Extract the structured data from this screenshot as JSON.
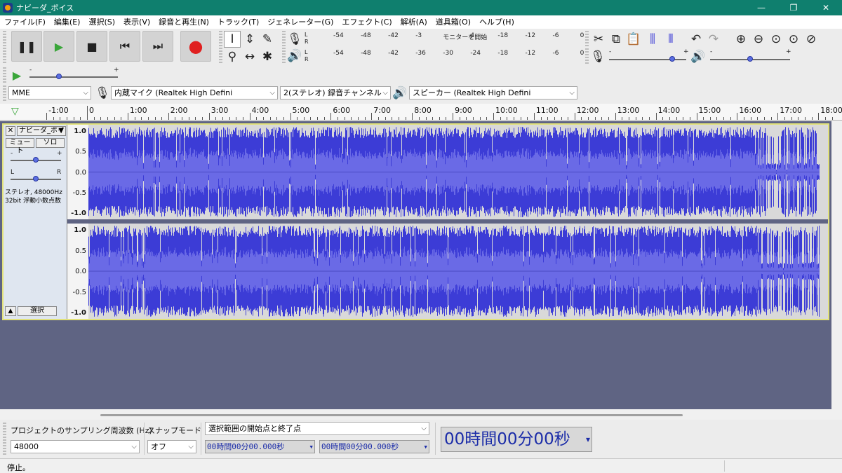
{
  "window": {
    "title": "ナビーダ_ボイス",
    "minimize_glyph": "—",
    "maximize_glyph": "❐",
    "close_glyph": "✕"
  },
  "menu": [
    "ファイル(F)",
    "編集(E)",
    "選択(S)",
    "表示(V)",
    "録音と再生(N)",
    "トラック(T)",
    "ジェネレーター(G)",
    "エフェクト(C)",
    "解析(A)",
    "道具箱(O)",
    "ヘルプ(H)"
  ],
  "transport": {
    "buttons": [
      {
        "name": "pause-button",
        "icon": "pause-icon",
        "glyph": "❚❚",
        "color": "#222222"
      },
      {
        "name": "play-button",
        "icon": "play-icon",
        "glyph": "▶",
        "color": "#3aa63a"
      },
      {
        "name": "stop-button",
        "icon": "stop-icon",
        "glyph": "■",
        "color": "#222222"
      },
      {
        "name": "skip-start-button",
        "icon": "skip-start-icon",
        "glyph": "⏮",
        "color": "#222222"
      },
      {
        "name": "skip-end-button",
        "icon": "skip-end-icon",
        "glyph": "⏭",
        "color": "#222222"
      },
      {
        "name": "record-button",
        "icon": "record-icon",
        "glyph": "●",
        "color": "#e02020"
      }
    ]
  },
  "tools": [
    {
      "name": "selection-tool",
      "icon": "i-beam-icon",
      "glyph": "I",
      "active": true
    },
    {
      "name": "envelope-tool",
      "icon": "envelope-icon",
      "glyph": "⇕",
      "active": false
    },
    {
      "name": "draw-tool",
      "icon": "pencil-icon",
      "glyph": "✎",
      "active": false
    },
    {
      "name": "zoom-tool",
      "icon": "magnifier-icon",
      "glyph": "⚲",
      "active": false
    },
    {
      "name": "time-shift-tool",
      "icon": "time-shift-icon",
      "glyph": "↔",
      "active": false
    },
    {
      "name": "multi-tool",
      "icon": "multi-tool-icon",
      "glyph": "✱",
      "active": false
    }
  ],
  "meters": {
    "record_ticks": [
      "-54",
      "-48",
      "-42",
      "-3",
      "モニターを開始",
      "4",
      "-18",
      "-12",
      "-6",
      "0"
    ],
    "play_ticks": [
      "-54",
      "-48",
      "-42",
      "-36",
      "-30",
      "-24",
      "-18",
      "-12",
      "-6",
      "0"
    ],
    "channel_left": "L",
    "channel_right": "R"
  },
  "edit_tools": [
    {
      "name": "cut-button",
      "icon": "scissors-icon",
      "glyph": "✂"
    },
    {
      "name": "copy-button",
      "icon": "copy-icon",
      "glyph": "⧉"
    },
    {
      "name": "paste-button",
      "icon": "paste-icon",
      "glyph": "📋"
    },
    {
      "name": "trim-button",
      "icon": "trim-icon",
      "glyph": "⫼"
    },
    {
      "name": "silence-button",
      "icon": "silence-icon",
      "glyph": "⫴"
    },
    {
      "name": "undo-button",
      "icon": "undo-icon",
      "glyph": "↶"
    },
    {
      "name": "redo-button",
      "icon": "redo-icon",
      "glyph": "↷"
    },
    {
      "name": "zoom-in-button",
      "icon": "zoom-in-icon",
      "glyph": "⊕"
    },
    {
      "name": "zoom-out-button",
      "icon": "zoom-out-icon",
      "glyph": "⊖"
    },
    {
      "name": "fit-selection-button",
      "icon": "fit-selection-icon",
      "glyph": "⊙"
    },
    {
      "name": "fit-project-button",
      "icon": "fit-project-icon",
      "glyph": "⊙"
    },
    {
      "name": "zoom-toggle-button",
      "icon": "zoom-toggle-icon",
      "glyph": "⊘"
    }
  ],
  "mixer": {
    "minus": "-",
    "plus": "+",
    "record_volume": 0.82,
    "play_volume": 0.5
  },
  "play_at_speed": {
    "minus": "-",
    "plus": "+",
    "speed": 0.33
  },
  "devices": {
    "host": "MME",
    "input": "内蔵マイク (Realtek High Defini",
    "channels": "2(ステレオ) 録音チャンネル",
    "output": "スピーカー (Realtek High Defini"
  },
  "ruler": {
    "labels": [
      "-1:00",
      "0",
      "1:00",
      "2:00",
      "3:00",
      "4:00",
      "5:00",
      "6:00",
      "7:00",
      "8:00",
      "9:00",
      "10:00",
      "11:00",
      "12:00",
      "13:00",
      "14:00",
      "15:00",
      "16:00",
      "17:00",
      "18:00"
    ]
  },
  "track": {
    "name": "ナビーダ_ボイ",
    "close_glyph": "✕",
    "menu_glyph": "▼",
    "mute": "ミュート",
    "solo": "ソロ",
    "gain_minus": "-",
    "gain_plus": "+",
    "pan_left": "L",
    "pan_right": "R",
    "gain": 0.5,
    "pan": 0.5,
    "format_line1": "ステレオ, 48000Hz",
    "format_line2": "32bit 浮動小数点数",
    "collapse_glyph": "▲",
    "select": "選択",
    "scale": [
      "1.0",
      "0.5",
      "0.0",
      "-0.5",
      "-1.0"
    ],
    "wave_color": "#3c3cd6",
    "rms_color": "#6a6ae6"
  },
  "bottom": {
    "rate_label": "プロジェクトのサンプリング周波数 (Hz)",
    "rate_value": "48000",
    "snap_label": "スナップモード",
    "snap_value": "オフ",
    "selection_mode": "選択範囲の開始点と終了点",
    "sel_start": "00時間00分00.000秒",
    "sel_end": "00時間00分00.000秒",
    "audio_position": "00時間00分00秒",
    "dropdown_glyph": "▾"
  },
  "status": "停止。"
}
